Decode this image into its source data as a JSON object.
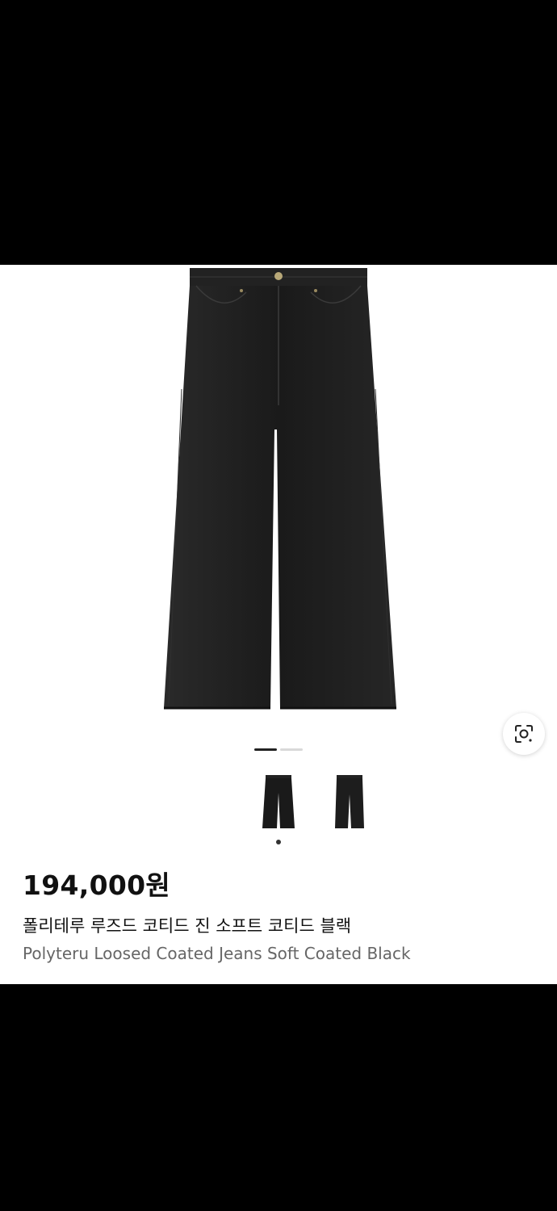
{
  "product": {
    "price": "194,000원",
    "name_ko": "폴리테루 루즈드 코티드 진 소프트 코티드 블랙",
    "name_en": "Polyteru Loosed Coated Jeans Soft Coated Black"
  },
  "gallery": {
    "image_count": 2,
    "active_index": 0,
    "thumbnails": [
      "jeans-front-thumbnail",
      "jeans-back-thumbnail"
    ],
    "lens_icon": "visual-search-icon"
  },
  "colors": {
    "background": "#000000",
    "card": "#ffffff",
    "denim": "#1c1c1c",
    "price_text": "#111111",
    "subtitle_text": "#666666"
  }
}
